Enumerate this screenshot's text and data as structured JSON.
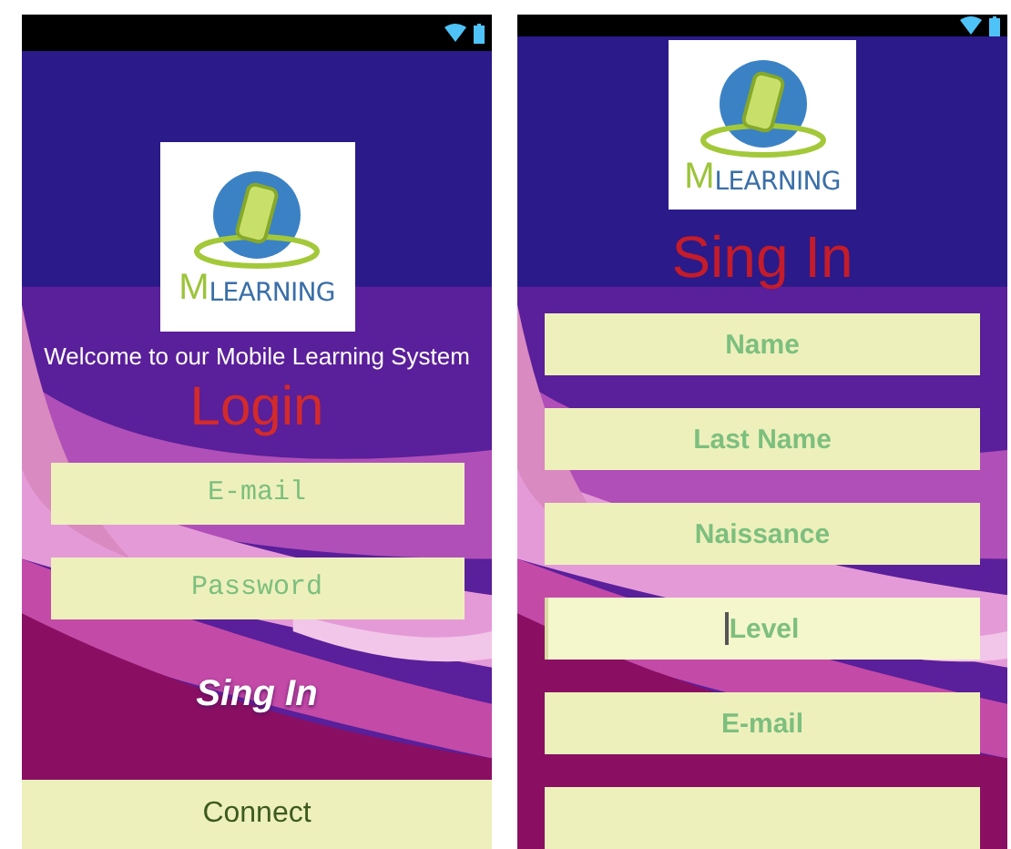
{
  "login_screen": {
    "logo": {
      "initial": "M",
      "word": "LEARNING"
    },
    "welcome": "Welcome to our Mobile Learning System",
    "title": "Login",
    "fields": [
      {
        "placeholder": "E-mail"
      },
      {
        "placeholder": "Password"
      }
    ],
    "sign_in_link": "Sing In",
    "connect_button": "Connect"
  },
  "signup_screen": {
    "logo": {
      "initial": "M",
      "word": "LEARNING"
    },
    "title": "Sing In",
    "fields": [
      {
        "placeholder": "Name",
        "focused": false
      },
      {
        "placeholder": "Last Name",
        "focused": false
      },
      {
        "placeholder": "Naissance",
        "focused": false
      },
      {
        "placeholder": "Level",
        "focused": true
      },
      {
        "placeholder": "E-mail",
        "focused": false
      },
      {
        "focused": false
      }
    ]
  }
}
